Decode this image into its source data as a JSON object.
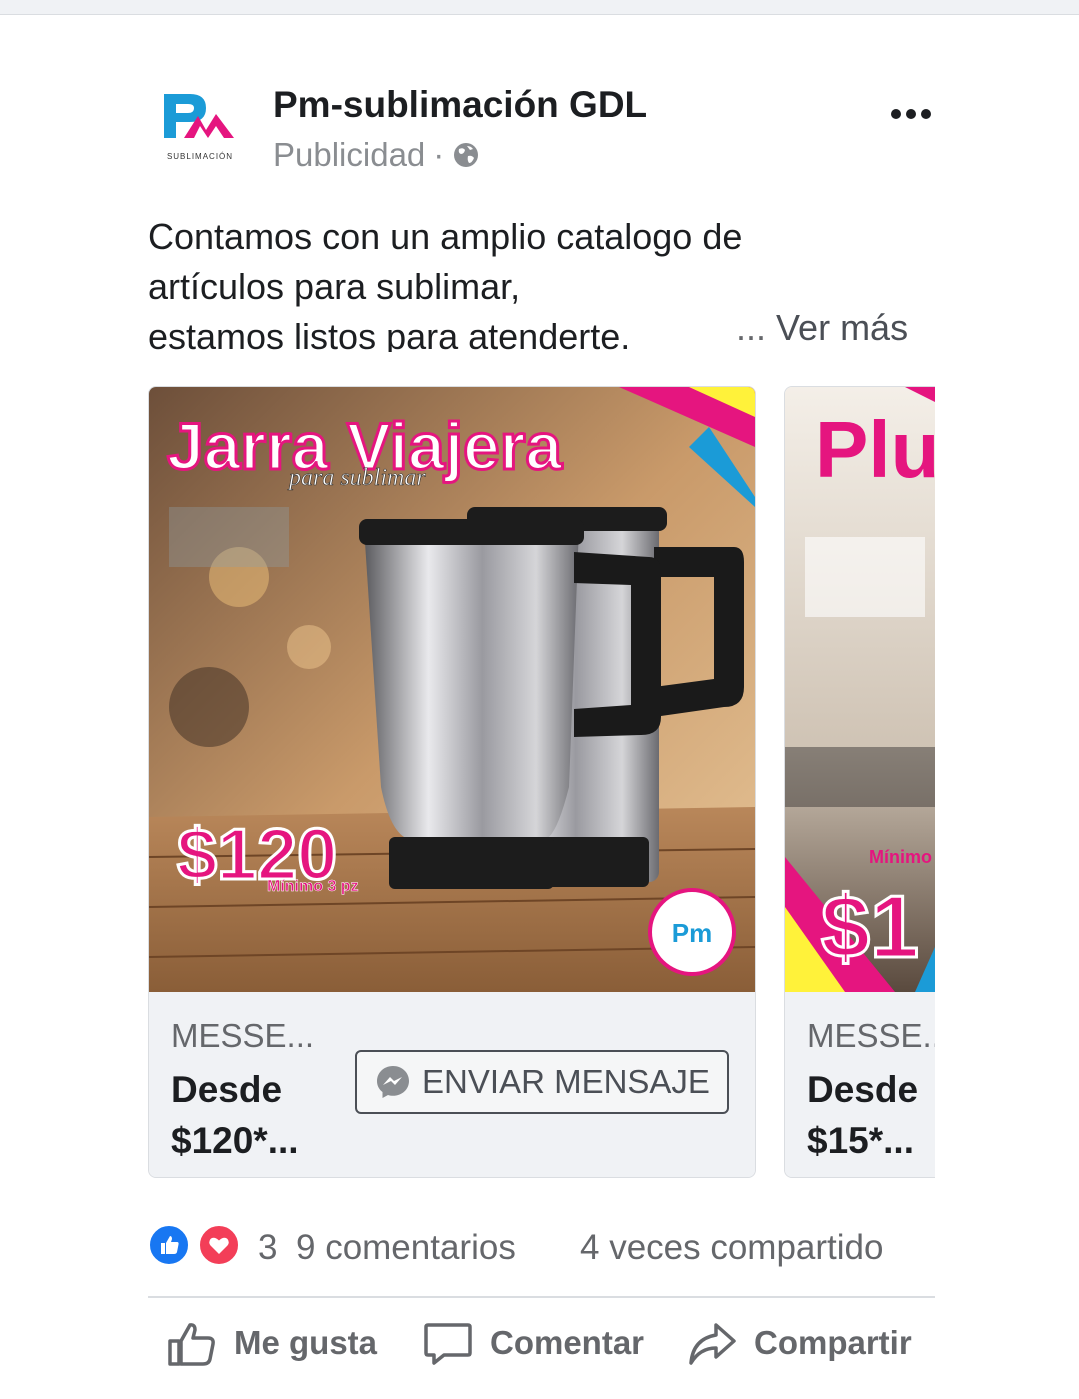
{
  "post": {
    "page_name": "Pm-sublimación GDL",
    "sponsored_label": "Publicidad",
    "separator": "·",
    "avatar_text": "SUBLIMACIÓN",
    "text_lines": [
      "Contamos con un amplio catalogo de",
      "artículos para sublimar,",
      "estamos listos para atenderte."
    ],
    "see_more_dots": "...",
    "see_more": "Ver más"
  },
  "carousel": {
    "cards": [
      {
        "image": {
          "title": "Jarra Viajera",
          "subtitle": "para sublimar",
          "price": "$120",
          "min_note": "Mínimo 3 pz"
        },
        "domain": "MESSE...",
        "headline_line1": "Desde",
        "headline_line2": "$120*...",
        "cta_label": "ENVIAR MENSAJE",
        "cta_icon": "messenger-icon"
      },
      {
        "image": {
          "title": "Plu",
          "price": "$1",
          "min_note": "Mínimo"
        },
        "domain": "MESSE...",
        "headline_line1": "Desde",
        "headline_line2": "$15*..."
      }
    ]
  },
  "stats": {
    "reactions": [
      "like-icon",
      "love-icon"
    ],
    "reaction_count": "3",
    "comments": "9 comentarios",
    "shares": "4 veces compartido"
  },
  "actions": {
    "like": "Me gusta",
    "comment": "Comentar",
    "share": "Compartir"
  },
  "colors": {
    "brand_blue": "#1b9bd7",
    "brand_magenta": "#e5157f",
    "like_blue": "#1877f2",
    "love_red": "#f33e58"
  }
}
